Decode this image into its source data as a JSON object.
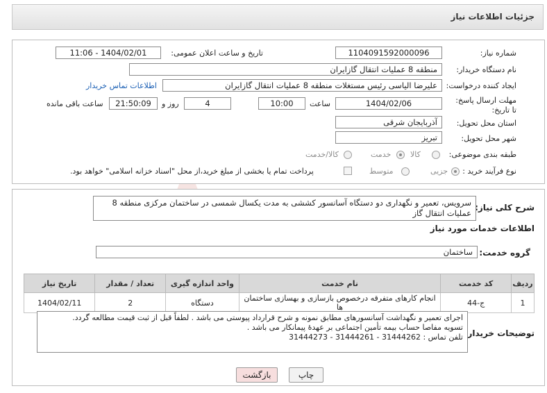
{
  "header": {
    "title": "جزئیات اطلاعات نیاز"
  },
  "form": {
    "need_number_label": "شماره نیاز:",
    "need_number": "1104091592000096",
    "announce_label": "تاریخ و ساعت اعلان عمومی:",
    "announce_value": "1404/02/01 - 11:06",
    "buyer_label": "نام دستگاه خریدار:",
    "buyer_value": "منطقه 8 عملیات انتقال گازایران",
    "creator_label": "ایجاد کننده درخواست:",
    "creator_value": "علیرضا الیاسی رئیس مستغلات منطقه 8 عملیات انتقال گازایران",
    "contact_link": "اطلاعات تماس خریدار",
    "deadline_label": "مهلت ارسال پاسخ: تا تاریخ:",
    "deadline_date": "1404/02/06",
    "time_label": "ساعت",
    "deadline_time": "10:00",
    "days_value": "4",
    "days_label": "روز و",
    "remaining_time": "21:50:09",
    "remaining_label": "ساعت باقی مانده",
    "province_label": "استان محل تحویل:",
    "province_value": "آذربایجان شرقی",
    "city_label": "شهر محل تحویل:",
    "city_value": "تبریز",
    "category_label": "طبقه بندی موضوعی:",
    "category_options": [
      "کالا",
      "خدمت",
      "کالا/خدمت"
    ],
    "category_selected": "خدمت",
    "process_label": "نوع فرآیند خرید :",
    "process_options": [
      "جزیی",
      "متوسط"
    ],
    "process_selected": "جزیی",
    "payment_note": "پرداخت تمام یا بخشی از مبلغ خرید،از محل \"اسناد خزانه اسلامی\" خواهد بود."
  },
  "description": {
    "label": "شرح کلی نیاز:",
    "text": "سرویس، تعمیر و نگهداری دو دستگاه آسانسور کششی به مدت یکسال شمسی در ساختمان مرکزی منطقه 8 عملیات انتقال گاز"
  },
  "services": {
    "section_title": "اطلاعات خدمات مورد نیاز",
    "group_label": "گروه خدمت:",
    "group_value": "ساختمان",
    "columns": [
      "ردیف",
      "کد خدمت",
      "نام خدمت",
      "واحد اندازه گیری",
      "تعداد / مقدار",
      "تاریخ نیاز"
    ],
    "rows": [
      [
        "1",
        "ج-44",
        "انجام کارهای متفرقه درخصوص بازسازی و بهسازی ساختمان ها",
        "دستگاه",
        "2",
        "1404/02/11"
      ]
    ]
  },
  "buyer_notes": {
    "label": "توضیحات خریدار:",
    "line1": "اجرای تعمیر و نگهداشت آسانسورهای مطابق نمونه و شرح قرارداد پیوستی می باشد . لطفاً قبل از ثبت قیمت مطالعه گردد.",
    "line2": "تسویه مفاصا حساب بیمه تأمین اجتماعی بر عهدۀ پیمانکار می باشد .",
    "line3": "تلفن تماس : 31444262 - 31444261 - 31444273"
  },
  "buttons": {
    "print": "چاپ",
    "back": "بازگشت"
  },
  "watermark": {
    "text": "AriaTender.net"
  },
  "colors": {
    "link": "#1a5fb4",
    "back_button_bg": "#f7dede",
    "header_bg": "#e6e6e6"
  }
}
